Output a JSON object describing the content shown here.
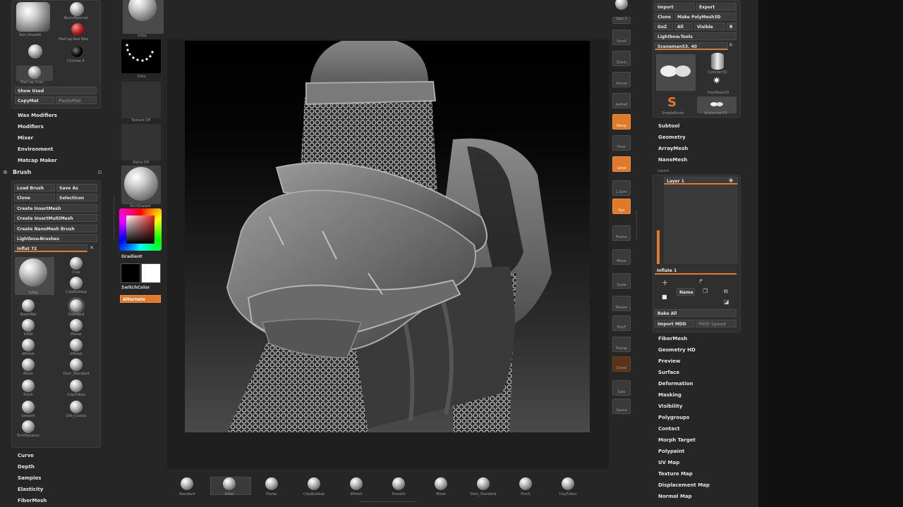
{
  "left_panel": {
    "matcaps": {
      "item1": "Skin Shade4",
      "item2": "BasicMaterial",
      "item3": "MatCap Red Wax",
      "item4": "Chrome A",
      "item5": "MatCap Gray"
    },
    "show_used": "Show Used",
    "copy_mat": "CopyMat",
    "paste_mat": "PasteMat",
    "menus": [
      "Wax Modifiers",
      "Modifiers",
      "Mixer",
      "Environment",
      "Matcap Maker"
    ]
  },
  "brush": {
    "title": "Brush",
    "load_brush": "Load Brush",
    "save_as": "Save As",
    "clone": "Clone",
    "select_icon": "SelectIcon",
    "create_insert_mesh": "Create InsertMesh",
    "create_insert_multi_mesh": "Create InsertMultiMesh",
    "create_nano_mesh_brush": "Create NanoMesh Brush",
    "lightbox_brushes": "Lightbox▸Brushes",
    "current_brush": "Inflat 72",
    "items": [
      {
        "name": "Inflat",
        "icon": "inflat-brush-icon"
      },
      {
        "name": "Clay",
        "icon": "clay-brush-icon"
      },
      {
        "name": "ClayBuildup",
        "icon": "claybuildup-brush-icon"
      },
      {
        "name": "BasicMat",
        "icon": "basicmat-brush-icon"
      },
      {
        "name": "Standard",
        "icon": "standard-brush-icon"
      },
      {
        "name": "Inflat",
        "icon": "inflat-brush-icon"
      },
      {
        "name": "Planar",
        "icon": "planar-brush-icon"
      },
      {
        "name": "dPolish",
        "icon": "dpolish-brush-icon"
      },
      {
        "name": "hPolish",
        "icon": "hpolish-brush-icon"
      },
      {
        "name": "Move",
        "icon": "move-brush-icon"
      },
      {
        "name": "Dam_Standard",
        "icon": "damstandard-brush-icon"
      },
      {
        "name": "Pinch",
        "icon": "pinch-brush-icon"
      },
      {
        "name": "ClayTubes",
        "icon": "claytubes-brush-icon"
      },
      {
        "name": "Smooth",
        "icon": "smooth-brush-icon"
      },
      {
        "name": "Orb_Cracks",
        "icon": "orbcracks-brush-icon"
      },
      {
        "name": "TrimDynamic",
        "icon": "trimdynamic-brush-icon"
      }
    ],
    "sub_menus": [
      "Curve",
      "Depth",
      "Samples",
      "Elasticity",
      "FiberMesh"
    ]
  },
  "shelf": {
    "items": [
      "Inflat",
      "Dots",
      "Texture Off",
      "Alpha Off",
      "SkinShade4"
    ],
    "gradient_label": "Gradient",
    "switch_color": "SwitchColor",
    "alternate": "Alternate"
  },
  "right_tools": [
    "Spix 3",
    "Scroll",
    "Zoom",
    "Actual",
    "AAHalf",
    "Persp",
    "Floor",
    "Local",
    "L.Sym",
    "Xyz",
    "Frame",
    "Move",
    "Scale",
    "Rotate",
    "PolyF",
    "Transp",
    "Ghost",
    "Solo",
    "Xpose"
  ],
  "tool_panel": {
    "import": "Import",
    "export": "Export",
    "clone": "Clone",
    "make_polymesh": "Make PolyMesh3D",
    "goz": "GoZ",
    "all": "All",
    "visible": "Visible",
    "r": "R",
    "lightbox_tools": "Lightbox▸Tools",
    "current_tool": "Sceneman53. 40",
    "tools": [
      "Sceneman53",
      "Cylinder3D",
      "SimpleBrush",
      "PolyMesh3D",
      "Sceneman53"
    ],
    "menus": [
      "Subtool",
      "Geometry",
      "ArrayMesh",
      "NanoMesh"
    ],
    "layers_title": "Layers",
    "layer1": "Layer 1",
    "inflate": "Inflate 1",
    "name_btn": "Name",
    "bake_all": "Bake All",
    "import_mdd": "Import MDD",
    "mdd_speed": "MDD Speed",
    "menus2": [
      "FiberMesh",
      "Geometry HD",
      "Preview",
      "Surface",
      "Deformation",
      "Masking",
      "Visibility",
      "Polygroups",
      "Contact",
      "Morph Target",
      "Polypaint",
      "UV Map",
      "Texture Map",
      "Displacement Map",
      "Normal Map"
    ]
  },
  "bottom_shelf": [
    {
      "name": "Standard",
      "icon": "standard-brush-icon"
    },
    {
      "name": "Inflat",
      "icon": "inflat-brush-icon"
    },
    {
      "name": "Planar",
      "icon": "planar-brush-icon"
    },
    {
      "name": "ClayBuildup",
      "icon": "claybuildup-brush-icon"
    },
    {
      "name": "dPolish",
      "icon": "dpolish-brush-icon"
    },
    {
      "name": "Smooth",
      "icon": "smooth-brush-icon"
    },
    {
      "name": "Move",
      "icon": "move-brush-icon"
    },
    {
      "name": "Dam_Standard",
      "icon": "damstandard-brush-icon"
    },
    {
      "name": "Pinch",
      "icon": "pinch-brush-icon"
    },
    {
      "name": "ClayTubes",
      "icon": "claytubes-brush-icon"
    }
  ],
  "colors": {
    "accent": "#e07a2a",
    "bg": "#262626",
    "panel": "#2f2f2f"
  }
}
